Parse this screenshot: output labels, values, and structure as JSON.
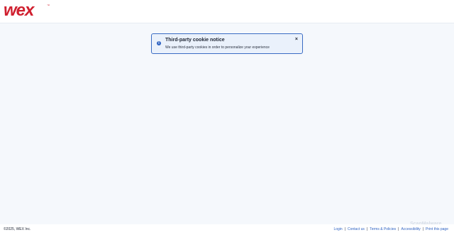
{
  "header": {
    "logo_text": "wex",
    "logo_tm": "™",
    "brand_color": "#d0202f"
  },
  "cookie_notice": {
    "icon": "info-icon",
    "title": "Third-party cookie notice",
    "text": "We use third-party cookies in order to personalize your experience",
    "close_glyph": "×",
    "border_color": "#3a6cc4"
  },
  "footer": {
    "copyright": "©2025, WEX Inc.",
    "links": [
      "Login",
      "Contact us",
      "Terms & Policies",
      "Accessibility",
      "Print this page"
    ],
    "link_color": "#2f63c2"
  },
  "watermark": "ScanMalware"
}
